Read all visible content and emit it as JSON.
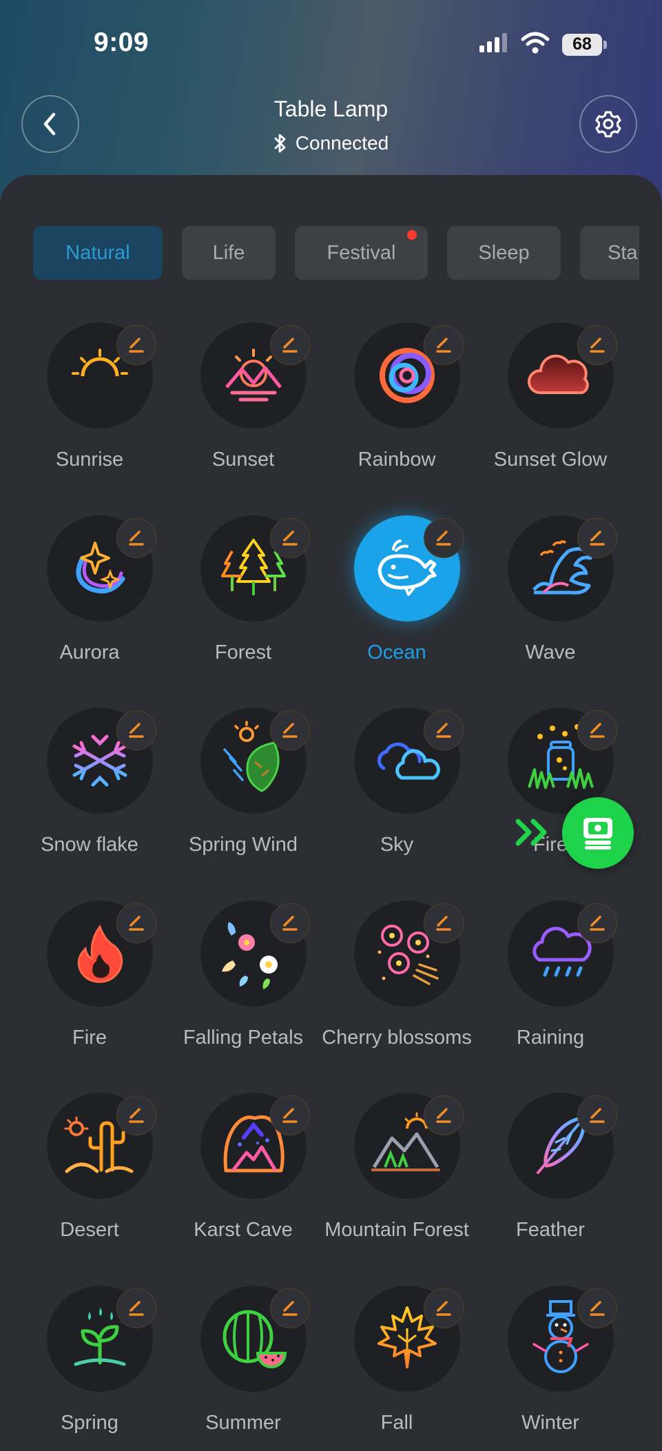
{
  "status_bar": {
    "time": "9:09",
    "battery": "68"
  },
  "header": {
    "title": "Table Lamp",
    "connection_status": "Connected"
  },
  "tabs": [
    {
      "label": "Natural",
      "active": true
    },
    {
      "label": "Life",
      "active": false
    },
    {
      "label": "Festival",
      "active": false,
      "badge": true
    },
    {
      "label": "Sleep",
      "active": false
    },
    {
      "label": "Sta",
      "active": false
    }
  ],
  "scenes": [
    {
      "label": "Sunrise",
      "icon": "sunrise-icon"
    },
    {
      "label": "Sunset",
      "icon": "sunset-icon"
    },
    {
      "label": "Rainbow",
      "icon": "rainbow-icon"
    },
    {
      "label": "Sunset Glow",
      "icon": "cloud-icon"
    },
    {
      "label": "Aurora",
      "icon": "aurora-icon"
    },
    {
      "label": "Forest",
      "icon": "forest-icon"
    },
    {
      "label": "Ocean",
      "icon": "whale-icon",
      "selected": true
    },
    {
      "label": "Wave",
      "icon": "wave-icon"
    },
    {
      "label": "Snow flake",
      "icon": "snowflake-icon"
    },
    {
      "label": "Spring Wind",
      "icon": "leaf-icon"
    },
    {
      "label": "Sky",
      "icon": "clouds-icon"
    },
    {
      "label": "Fire",
      "icon": "fireflies-jar-icon"
    },
    {
      "label": "Fire",
      "icon": "flame-icon"
    },
    {
      "label": "Falling Petals",
      "icon": "petals-icon"
    },
    {
      "label": "Cherry blossoms",
      "icon": "cherry-blossom-icon"
    },
    {
      "label": "Raining",
      "icon": "rain-cloud-icon"
    },
    {
      "label": "Desert",
      "icon": "cactus-icon"
    },
    {
      "label": "Karst Cave",
      "icon": "cave-icon"
    },
    {
      "label": "Mountain Forest",
      "icon": "mountain-icon"
    },
    {
      "label": "Feather",
      "icon": "feather-icon"
    },
    {
      "label": "Spring",
      "icon": "sprout-icon"
    },
    {
      "label": "Summer",
      "icon": "watermelon-icon"
    },
    {
      "label": "Fall",
      "icon": "maple-leaf-icon"
    },
    {
      "label": "Winter",
      "icon": "snowman-icon"
    }
  ],
  "colors": {
    "accent": "#1aa3e8",
    "edit_icon": "#f28c28",
    "float_button": "#1ed34a"
  }
}
